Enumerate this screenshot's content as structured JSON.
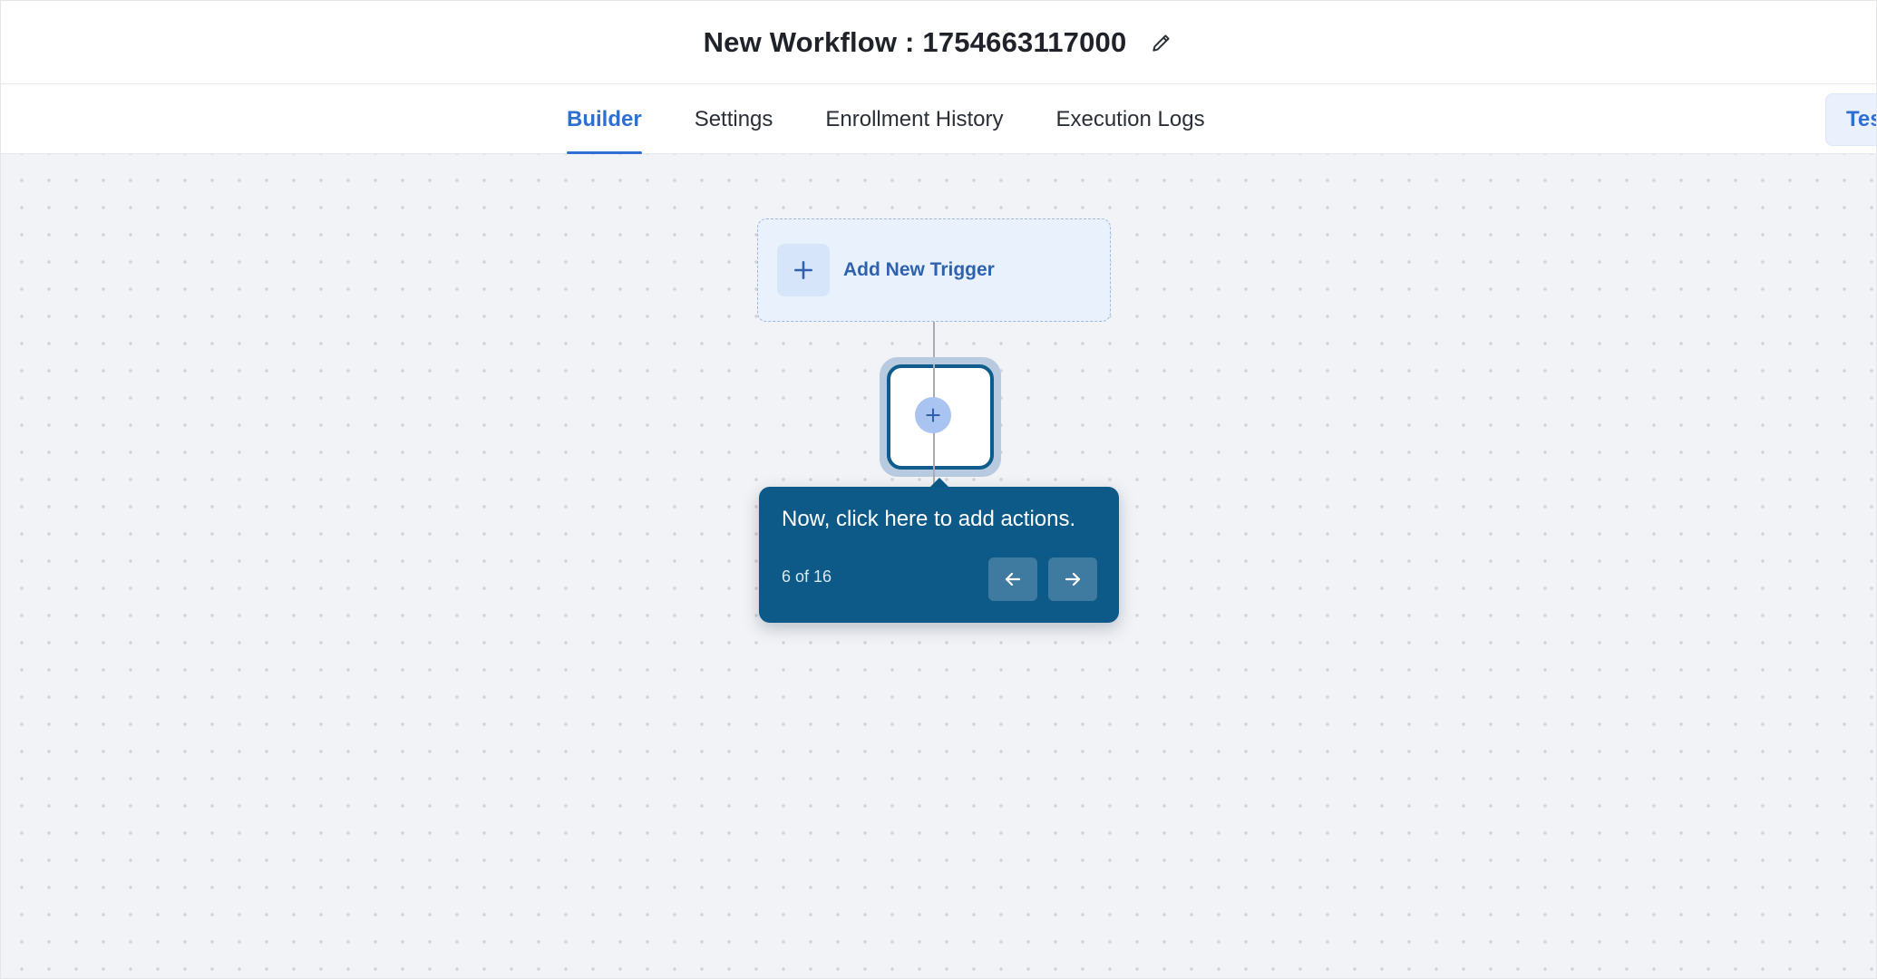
{
  "header": {
    "title": "New Workflow : 1754663117000",
    "edit_icon": "pencil-icon"
  },
  "tabs": [
    {
      "label": "Builder",
      "active": true
    },
    {
      "label": "Settings",
      "active": false
    },
    {
      "label": "Enrollment History",
      "active": false
    },
    {
      "label": "Execution Logs",
      "active": false
    }
  ],
  "test_button": {
    "label": "Tes"
  },
  "canvas": {
    "trigger": {
      "label": "Add New Trigger",
      "icon": "plus-icon"
    },
    "add_action": {
      "icon": "plus-icon"
    }
  },
  "tour": {
    "message": "Now, click here to add actions.",
    "step": "6 of 16",
    "prev_icon": "arrow-left-icon",
    "next_icon": "arrow-right-icon"
  },
  "colors": {
    "accent": "#2f6fd1",
    "tooltip_bg": "#0d5a88",
    "canvas_bg": "#f2f3f6"
  }
}
